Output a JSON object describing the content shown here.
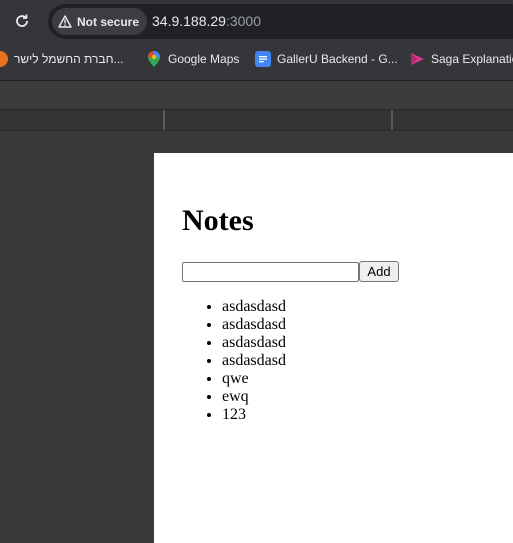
{
  "browser": {
    "security_label": "Not secure",
    "url_host": "34.9.188.29",
    "url_port": ":3000"
  },
  "bookmarks": [
    {
      "label": "חברת החשמל לישר...",
      "icon": "globe-orange-icon"
    },
    {
      "label": "Google Maps",
      "icon": "maps-pin-icon"
    },
    {
      "label": "GallerU Backend - G...",
      "icon": "docs-icon"
    },
    {
      "label": "Saga Explanation",
      "icon": "play-icon"
    }
  ],
  "app": {
    "title": "Notes",
    "input_value": "",
    "add_label": "Add",
    "notes": [
      "asdasdasd",
      "asdasdasd",
      "asdasdasd",
      "asdasdasd",
      "qwe",
      "ewq",
      "123"
    ]
  }
}
